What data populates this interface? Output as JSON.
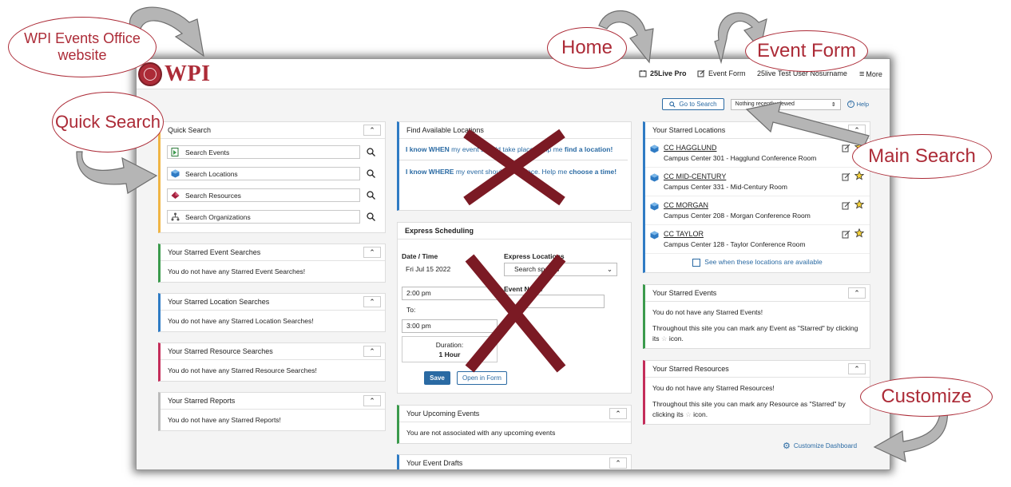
{
  "annotations": {
    "events_office": "WPI Events Office website",
    "home": "Home",
    "event_form": "Event Form",
    "quick_search": "Quick Search",
    "main_search": "Main Search",
    "customize": "Customize"
  },
  "header": {
    "logo_text": "WPI",
    "nav_pro": "25Live Pro",
    "nav_form": "Event Form",
    "user": "25live Test User Nosurname",
    "more": "More"
  },
  "subbar": {
    "go_search": "Go to Search",
    "recent": "Nothing recently viewed",
    "help": "Help"
  },
  "quick_search": {
    "title": "Quick Search",
    "items": [
      {
        "label": "Search Events",
        "icon": "events-icon"
      },
      {
        "label": "Search Locations",
        "icon": "locations-icon"
      },
      {
        "label": "Search Resources",
        "icon": "resources-icon"
      },
      {
        "label": "Search Organizations",
        "icon": "organizations-icon"
      }
    ]
  },
  "starred_cards": [
    {
      "title": "Your Starred Event Searches",
      "msg": "You do not have any Starred Event Searches!"
    },
    {
      "title": "Your Starred Location Searches",
      "msg": "You do not have any Starred Location Searches!"
    },
    {
      "title": "Your Starred Resource Searches",
      "msg": "You do not have any Starred Resource Searches!"
    },
    {
      "title": "Your Starred Reports",
      "msg": "You do not have any Starred Reports!"
    }
  ],
  "find_locations": {
    "title": "Find Available Locations",
    "when_lead": "I know WHEN",
    "when_mid": " my event should take place. Help me ",
    "when_cta": "find a location!",
    "where_lead": "I know WHERE",
    "where_mid": " my event should take place. Help me ",
    "where_cta": "choose a time!"
  },
  "express": {
    "title": "Express Scheduling",
    "date_label": "Date / Time",
    "date": "Fri Jul 15 2022",
    "loc_label": "Express Locations",
    "loc_placeholder": "Search spaces",
    "name_label": "Event Name",
    "start": "2:00 pm",
    "to": "To:",
    "end": "3:00 pm",
    "dur_label": "Duration:",
    "dur": "1 Hour",
    "save": "Save",
    "open": "Open in Form"
  },
  "upcoming": {
    "title": "Your Upcoming Events",
    "msg": "You are not associated with any upcoming events"
  },
  "drafts": {
    "title": "Your Event Drafts"
  },
  "starred_locations": {
    "title": "Your Starred Locations",
    "items": [
      {
        "name": "CC HAGGLUND",
        "full": "Campus Center 301 - Hagglund Conference Room"
      },
      {
        "name": "CC MID-CENTURY",
        "full": "Campus Center 331 - Mid-Century Room"
      },
      {
        "name": "CC MORGAN",
        "full": "Campus Center 208 - Morgan Conference Room"
      },
      {
        "name": "CC TAYLOR",
        "full": "Campus Center 128 - Taylor Conference Room"
      }
    ],
    "avail": "See when these locations are available"
  },
  "starred_events": {
    "title": "Your Starred Events",
    "msg1": "You do not have any Starred Events!",
    "msg2a": "Throughout this site you can mark any Event as \"Starred\" by clicking its",
    "msg2b": "icon."
  },
  "starred_resources": {
    "title": "Your Starred Resources",
    "msg1": "You do not have any Starred Resources!",
    "msg2a": "Throughout this site you can mark any Resource as \"Starred\" by clicking its",
    "msg2b": "icon."
  },
  "customize": "Customize Dashboard",
  "colors": {
    "maroon": "#ac2b37",
    "link": "#2a6aa3",
    "cross": "#7b1a24"
  }
}
